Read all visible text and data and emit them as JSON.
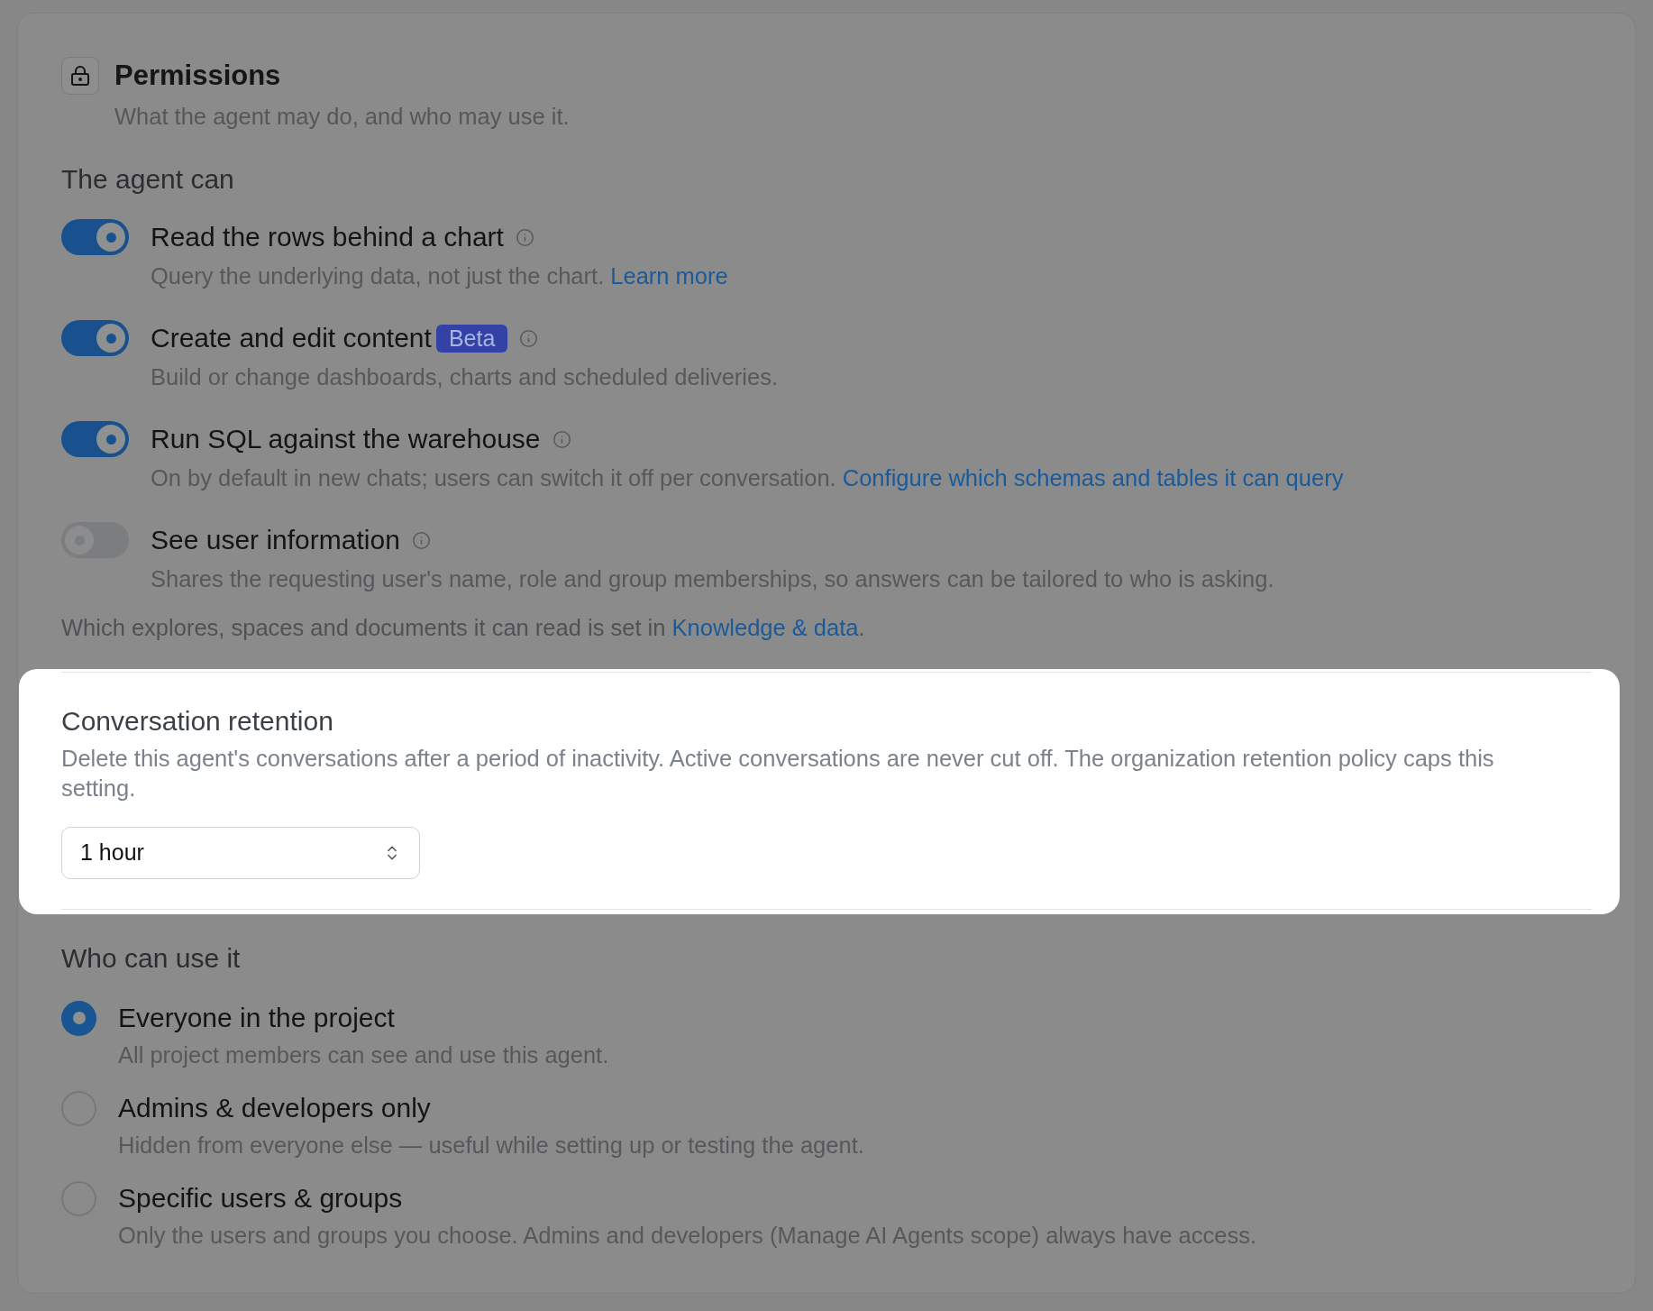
{
  "header": {
    "title": "Permissions",
    "subtitle": "What the agent may do, and who may use it."
  },
  "capabilities": {
    "heading": "The agent can",
    "items": [
      {
        "label": "Read the rows behind a chart",
        "on": true,
        "description": "Query the underlying data, not just the chart.",
        "link": "Learn more"
      },
      {
        "label": "Create and edit content",
        "badge": "Beta",
        "on": true,
        "description": "Build or change dashboards, charts and scheduled deliveries."
      },
      {
        "label": "Run SQL against the warehouse",
        "on": true,
        "description": "On by default in new chats; users can switch it off per conversation.",
        "link": "Configure which schemas and tables it can query"
      },
      {
        "label": "See user information",
        "on": false,
        "description": "Shares the requesting user's name, role and group memberships, so answers can be tailored to who is asking."
      }
    ],
    "footnote": {
      "text": "Which explores, spaces and documents it can read is set in",
      "link": "Knowledge & data",
      "end": "."
    }
  },
  "retention": {
    "highlighted": true,
    "heading": "Conversation retention",
    "description": "Delete this agent's conversations after a period of inactivity. Active conversations are never cut off. The organization retention policy caps this setting.",
    "select": {
      "value": "1 hour"
    }
  },
  "access": {
    "heading": "Who can use it",
    "options": [
      {
        "label": "Everyone in the project",
        "description": "All project members can see and use this agent.",
        "selected": true
      },
      {
        "label": "Admins & developers only",
        "description": "Hidden from everyone else — useful while setting up or testing the agent.",
        "selected": false
      },
      {
        "label": "Specific users & groups",
        "description": "Only the users and groups you choose. Admins and developers (Manage AI Agents scope) always have access.",
        "selected": false
      }
    ]
  }
}
